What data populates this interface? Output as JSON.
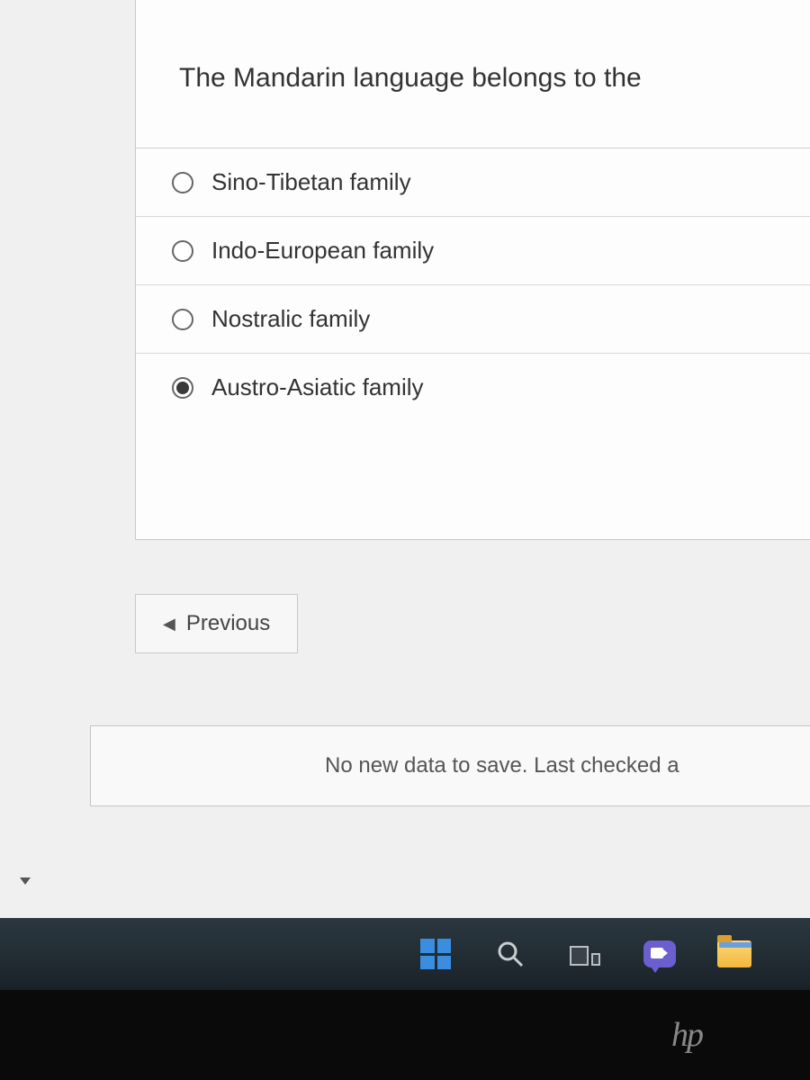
{
  "question": {
    "prompt": "The Mandarin language belongs to the",
    "options": [
      {
        "label": "Sino-Tibetan family",
        "selected": false
      },
      {
        "label": "Indo-European family",
        "selected": false
      },
      {
        "label": "Nostralic family",
        "selected": false
      },
      {
        "label": "Austro-Asiatic family",
        "selected": true
      }
    ]
  },
  "nav": {
    "previous_label": "Previous"
  },
  "status": {
    "message": "No new data to save. Last checked a"
  },
  "taskbar": {
    "items": [
      "start",
      "search",
      "task-view",
      "chat",
      "file-explorer"
    ]
  },
  "bezel": {
    "brand": "hp"
  }
}
